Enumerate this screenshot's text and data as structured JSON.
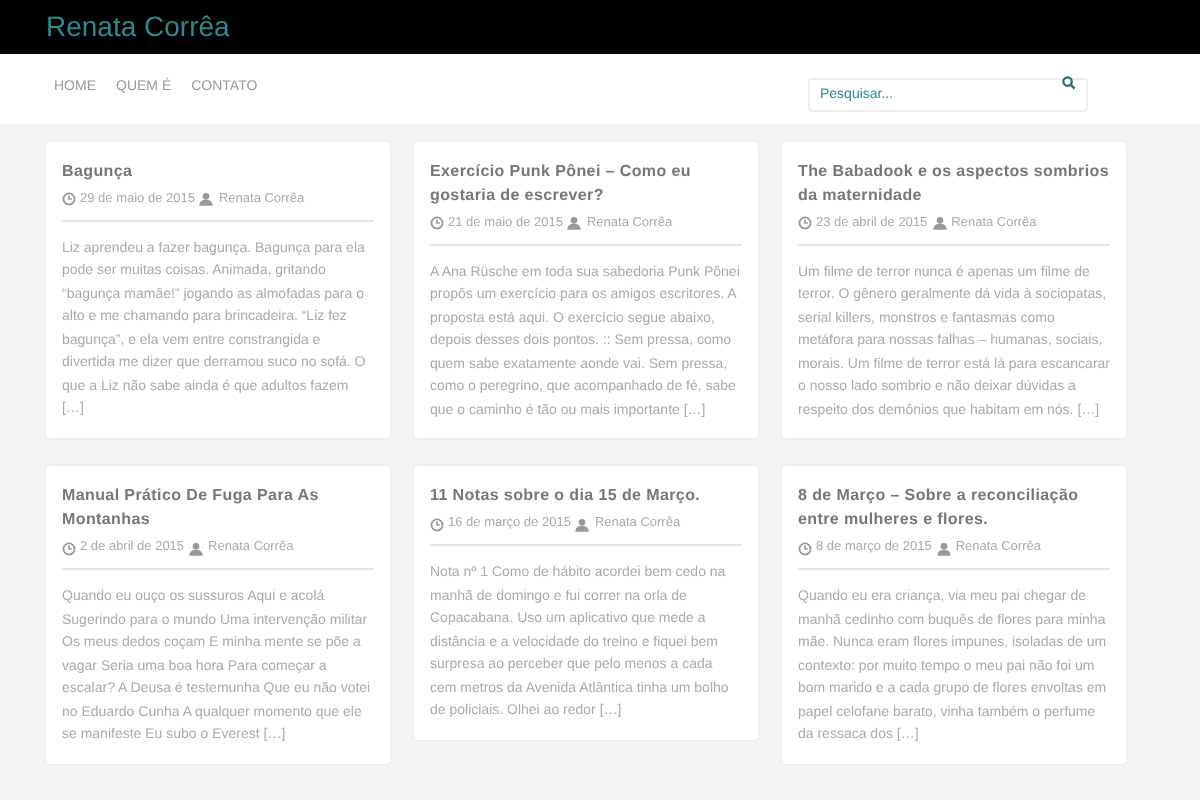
{
  "site_title": "Renata Corrêa",
  "nav": [
    {
      "label": "HOME",
      "selected": false
    },
    {
      "label": "QUEM É",
      "selected": false
    },
    {
      "label": "CONTATO",
      "selected": false
    }
  ],
  "search": {
    "placeholder": "Pesquisar..."
  },
  "posts": [
    {
      "title": "Bagunça",
      "date": "29 de maio de 2015",
      "author": "Renata Corrêa",
      "excerpt": "Liz aprendeu a fazer bagunça. Bagunça para ela pode ser muitas coisas. Animada, gritando “bagunça mamãe!” jogando as almofadas para o alto e me chamando para brincadeira. “Liz fez bagunça”, e ela vem entre constrangida e divertida me dizer que derramou suco no sofá. O que a Liz não sabe ainda é que adultos fazem […]"
    },
    {
      "title": "Exercício Punk Pônei – Como eu gostaria de escrever?",
      "date": "21 de maio de 2015",
      "author": "Renata Corrêa",
      "excerpt": "A Ana Rüsche em toda sua sabedoria Punk Pônei propôs um exercício para os amigos escritores. A proposta está aqui. O exercício segue abaixo, depois desses dois pontos. :: Sem pressa, como quem sabe exatamente aonde vai. Sem pressa, como o peregrino, que acompanhado de fé, sabe que o caminho é tão ou mais importante […]"
    },
    {
      "title": "The Babadook e os aspectos sombrios da maternidade",
      "date": "23 de abril de 2015",
      "author": "Renata Corrêa",
      "excerpt": "Um filme de terror nunca é apenas um filme de terror. O gênero geralmente dá vida à sociopatas, serial killers, monstros e fantasmas como metáfora para nossas falhas – humanas, sociais, morais. Um filme de terror está lá para escancarar o nosso lado sombrio e não deixar dúvidas a respeito dos demônios que habitam em nós. […]"
    },
    {
      "title": "Manual Prático De Fuga Para As Montanhas",
      "date": "2 de abril de 2015",
      "author": "Renata Corrêa",
      "excerpt": "Quando eu ouço os sussuros Aqui e acolá Sugerindo para o mundo Uma intervenção militar Os meus dedos coçam E minha mente se põe a vagar Seria uma boa hora Para começar a escalar? A Deusa é testemunha Que eu não votei no Eduardo Cunha A qualquer momento que ele se manifeste Eu subo o Everest […]"
    },
    {
      "title": "11 Notas sobre o dia 15 de Março.",
      "date": "16 de março de 2015",
      "author": "Renata Corrêa",
      "excerpt": "Nota nº 1 Como de hábito acordei bem cedo na manhã de domingo e fui correr na orla de Copacabana. Uso um aplicativo que mede a distância e a velocidade do treino e fiquei bem surpresa ao perceber que pelo menos a cada cem metros da Avenida Atlântica tinha um bolho de policiais. Olhei ao redor […]"
    },
    {
      "title": "8 de Março – Sobre a reconciliação entre mulheres e flores.",
      "date": "8 de março de 2015",
      "author": "Renata Corrêa",
      "excerpt": "Quando eu era criança, via meu pai chegar de manhã cedinho com buquês de flores para minha mãe. Nunca eram flores impunes, isoladas de um contexto: por muito tempo o meu pai não foi um bom marido e a cada grupo de flores envoltas em papel celofane barato, vinha também o perfume da ressaca dos […]"
    }
  ]
}
